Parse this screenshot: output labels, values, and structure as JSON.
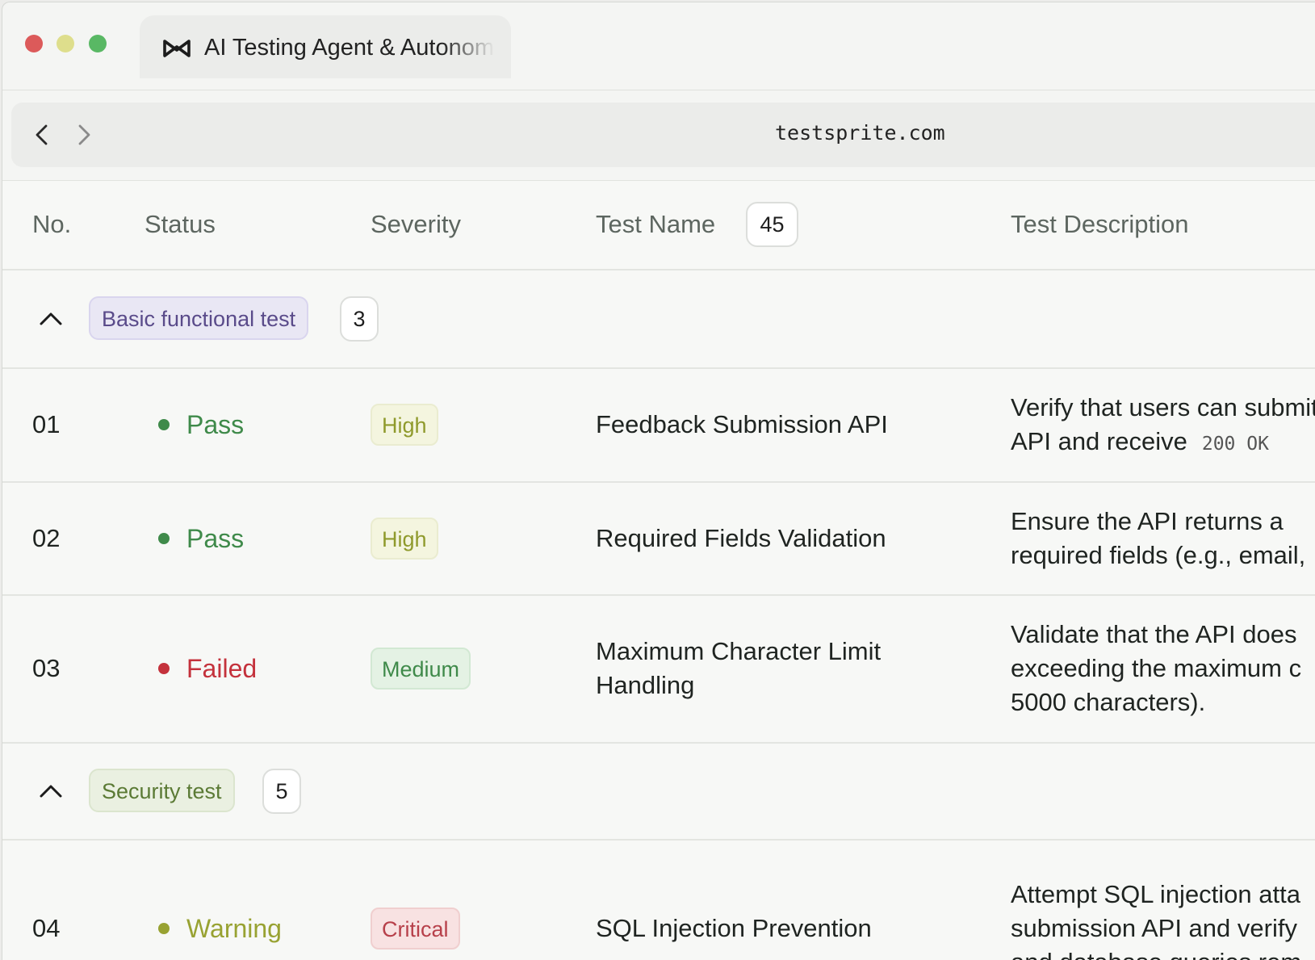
{
  "browser": {
    "tab_title": "AI Testing Agent & Autonomous",
    "url": "testsprite.com"
  },
  "table": {
    "headers": {
      "no": "No.",
      "status": "Status",
      "severity": "Severity",
      "test_name": "Test Name",
      "test_name_count": "45",
      "test_description": "Test Description"
    },
    "groups": [
      {
        "label": "Basic functional test",
        "count": "3",
        "color": "#5a4b8a"
      },
      {
        "label": "Security test",
        "count": "5",
        "color": "#5b7a35"
      }
    ],
    "rows": [
      {
        "no": "01",
        "status": "Pass",
        "severity": "High",
        "name_lines": [
          "Feedback Submission API"
        ],
        "desc_lines": [
          "Verify that users can submit",
          "API and receive"
        ],
        "desc_code": "200 OK"
      },
      {
        "no": "02",
        "status": "Pass",
        "severity": "High",
        "name_lines": [
          "Required Fields Validation"
        ],
        "desc_lines": [
          "Ensure the API returns a",
          "required fields (e.g., email,"
        ]
      },
      {
        "no": "03",
        "status": "Failed",
        "severity": "Medium",
        "name_lines": [
          "Maximum Character Limit",
          "Handling"
        ],
        "desc_lines": [
          "Validate that the API does",
          "exceeding the maximum c",
          "5000 characters)."
        ]
      },
      {
        "no": "04",
        "status": "Warning",
        "severity": "Critical",
        "name_lines": [
          "SQL Injection Prevention"
        ],
        "desc_lines": [
          "Attempt SQL injection atta",
          "submission API and verify",
          "and database queries rem"
        ]
      }
    ]
  },
  "colors": {
    "pass": "#3f8a4a",
    "failed": "#c4323c",
    "warning": "#98a232"
  }
}
